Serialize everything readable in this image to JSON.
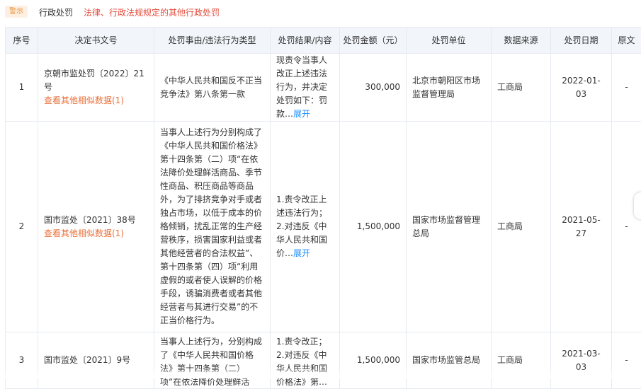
{
  "header": {
    "tag": "警示",
    "record_type": "行政处罚",
    "description": "法律、行政法规规定的其他行政处罚"
  },
  "table": {
    "columns": [
      "序号",
      "决定书文号",
      "处罚事由/违法行为类型",
      "处罚结果/内容",
      "处罚金额（元）",
      "处罚单位",
      "数据来源",
      "处罚日期",
      "原文"
    ],
    "rows": [
      {
        "index": "1",
        "doc_no": "京朝市监处罚〔2022〕21号",
        "similar_link": "查看其他相似数据(1)",
        "reason": "《中华人民共和国反不正当竞争法》第八条第一款",
        "result": "现责令当事人改正上述违法行为，并决定处罚如下：罚款…",
        "expand": "展开",
        "amount": "300,000",
        "unit": "北京市朝阳区市场监督管理局",
        "source": "工商局",
        "date": "2022-01-03",
        "original": "-"
      },
      {
        "index": "2",
        "doc_no": "国市监处〔2021〕38号",
        "similar_link": "查看其他相似数据(1)",
        "reason": "当事人上述行为分别构成了《中华人民共和国价格法》第十四条第（二）项“在依法降价处理鲜活商品、季节性商品、积压商品等商品外，为了排挤竞争对手或者独占市场，以低于成本的价格倾销，扰乱正常的生产经营秩序，损害国家利益或者其他经营者的合法权益”、第十四条第（四）项“利用虚假的或者使人误解的价格手段，诱骗消费者或者其他经营者与其进行交易”的不正当价格行为。",
        "result": "1.责令改正上述违法行为；2.对违反《中华人民共和国价…",
        "expand": "展开",
        "amount": "1,500,000",
        "unit": "国家市场监督管理总局",
        "source": "工商局",
        "date": "2021-05-27",
        "original": "-"
      },
      {
        "index": "3",
        "doc_no": "国市监处〔2021〕9号",
        "similar_link": "",
        "reason": "当事人上述行为，分别构成了《中华人民共和国价格法》第十四条第（二）项“在依法降价处理鲜活商…",
        "result": "1.责令改正；2.对违反《中华人民共和国价格法》第…",
        "expand": "展开",
        "amount": "1,500,000",
        "unit": "国家市场监管总局",
        "source": "工商局",
        "date": "2021-03-03",
        "original": "-"
      }
    ]
  }
}
